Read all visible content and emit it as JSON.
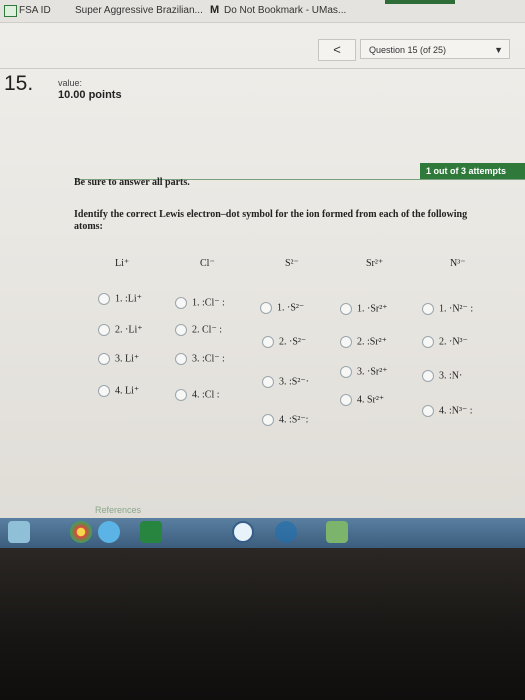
{
  "bookmarks": {
    "fsa": "FSA ID",
    "brazilian": "Super Aggressive Brazilian...",
    "m_icon": "M",
    "umass": "Do Not Bookmark - UMas..."
  },
  "nav": {
    "back": "<",
    "question_select": "Question 15 (of 25)",
    "caret": "▼"
  },
  "question": {
    "number": "15.",
    "value_label": "value:",
    "value_points": "10.00 points"
  },
  "attempts": "1 out of 3 attempts",
  "instructions": {
    "line1": "Be sure to answer all parts.",
    "line2": "Identify the correct Lewis electron–dot symbol for the ion formed from each of the following atoms:"
  },
  "columns": [
    {
      "header": "Li⁺",
      "options": [
        "1.  :Li⁺",
        "2.  ·Li⁺",
        "3.  Li⁺",
        "4.  Li⁺"
      ]
    },
    {
      "header": "Cl⁻",
      "options": [
        "1.  :Cl⁻ :",
        "2.  Cl⁻ :",
        "3.  :Cl⁻ :",
        "4.  :Cl :"
      ]
    },
    {
      "header": "S²⁻",
      "options": [
        "1.  ·S²⁻",
        "2.  ·S²⁻",
        "3.  :S²⁻·",
        "4.  :S²⁻:"
      ]
    },
    {
      "header": "Sr²⁺",
      "options": [
        "1.  ·Sr²⁺",
        "2.  :Sr²⁺",
        "3.  ·Sr²⁺",
        "4.  Sr²⁺"
      ]
    },
    {
      "header": "N³⁻",
      "options": [
        "1.  ·N²⁻ :",
        "2.  ·N³⁻",
        "3.  :N·",
        "4.  :N³⁻ :"
      ]
    }
  ],
  "references": "References",
  "colors": {
    "accent_green": "#2f7a3b",
    "taskbar": "#3b5d7e"
  }
}
